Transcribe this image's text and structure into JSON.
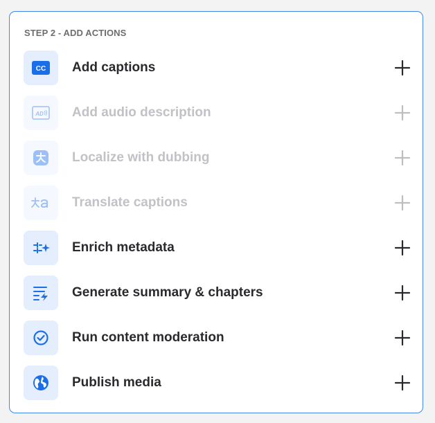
{
  "step_title": "STEP 2 - ADD ACTIONS",
  "colors": {
    "accent": "#1a6ee8",
    "icon_bg": "#e4eefd",
    "border": "#3f86e8",
    "text": "#2a2a2e",
    "disabled_text": "#c2c2c6"
  },
  "actions": [
    {
      "label": "Add captions",
      "icon": "cc-icon",
      "cc_text": "CC",
      "enabled": true
    },
    {
      "label": "Add audio description",
      "icon": "audio-description-icon",
      "ad_text": "AD",
      "enabled": false
    },
    {
      "label": "Localize with dubbing",
      "icon": "dubbing-icon",
      "enabled": false
    },
    {
      "label": "Translate captions",
      "icon": "translate-icon",
      "enabled": false
    },
    {
      "label": "Enrich metadata",
      "icon": "enrich-sparkle-icon",
      "enabled": true
    },
    {
      "label": "Generate summary & chapters",
      "icon": "summary-list-icon",
      "enabled": true
    },
    {
      "label": "Run content moderation",
      "icon": "check-circle-icon",
      "enabled": true
    },
    {
      "label": "Publish media",
      "icon": "globe-icon",
      "enabled": true
    }
  ]
}
